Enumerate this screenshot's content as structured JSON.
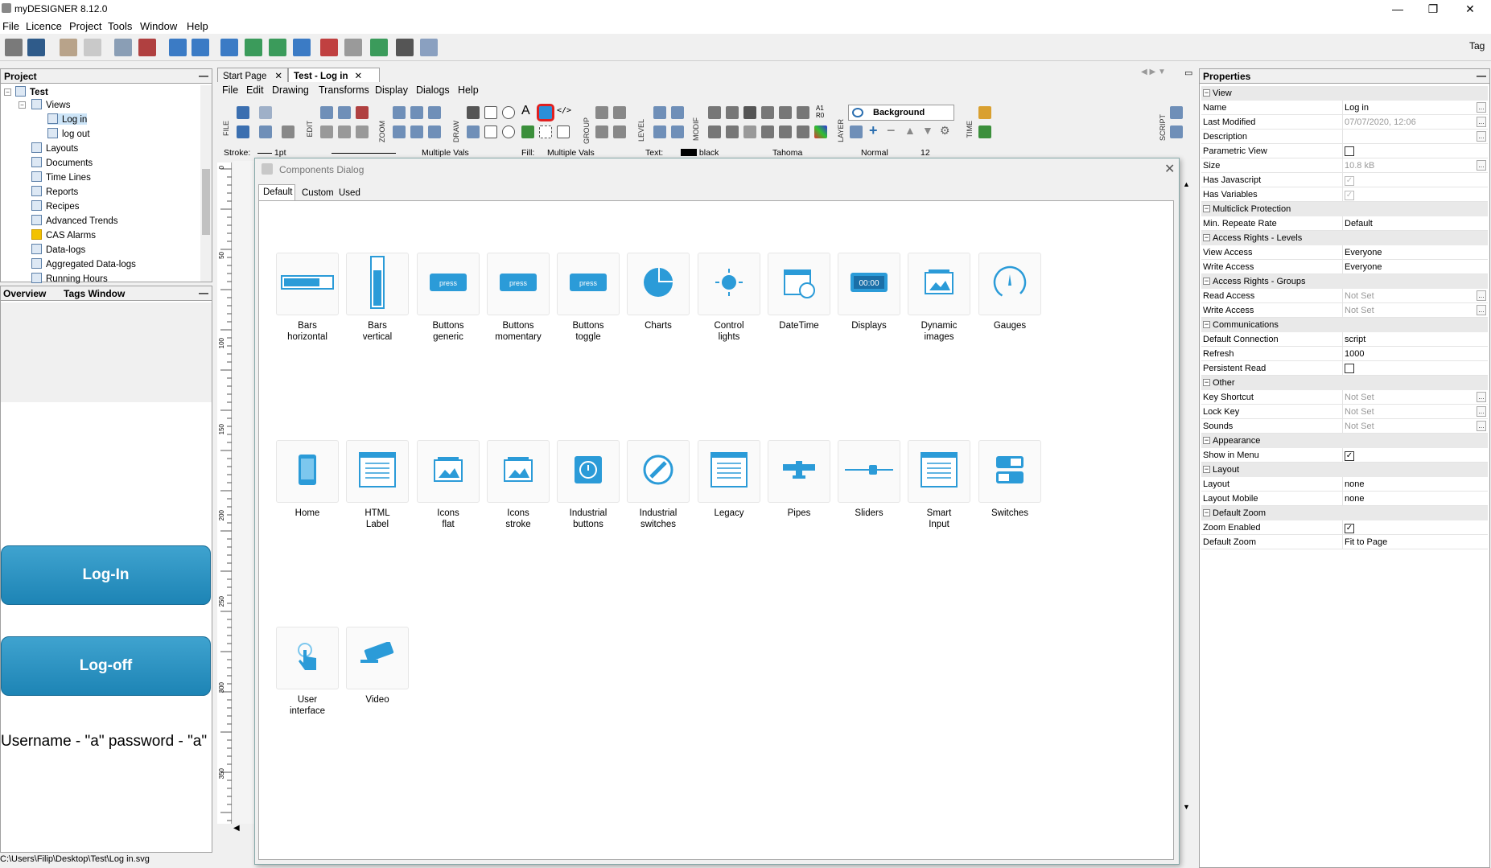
{
  "app": {
    "title": "myDESIGNER 8.12.0"
  },
  "window_controls": {
    "min": "—",
    "max": "❐",
    "close": "✕"
  },
  "menubar": [
    "File",
    "Licence",
    "Project",
    "Tools",
    "Window",
    "Help"
  ],
  "toolbar_right_label": "Tag",
  "project_panel": {
    "title": "Project",
    "root": "Test",
    "views": "Views",
    "view_items": [
      "Log in",
      "log out"
    ],
    "items": [
      "Layouts",
      "Documents",
      "Time Lines",
      "Reports",
      "Recipes",
      "Advanced Trends",
      "CAS Alarms",
      "Data-logs",
      "Aggregated Data-logs",
      "Running Hours"
    ]
  },
  "bottom_tabs": [
    "Overview",
    "Tags Window"
  ],
  "canvas_preview": {
    "login": "Log-In",
    "logoff": "Log-off",
    "hint": "Username - \"a\" password - \"a\""
  },
  "status_path": "C:\\Users\\Filip\\Desktop\\Test\\Log in.svg",
  "doc_tabs": [
    "Start Page",
    "Test - Log in"
  ],
  "doc_menu": [
    "File",
    "Edit",
    "Drawing",
    "Transforms",
    "Display",
    "Dialogs",
    "Help"
  ],
  "tool_groups": [
    "FILE",
    "EDIT",
    "ZOOM",
    "DRAW",
    "GROUP",
    "LEVEL",
    "MODIF",
    "LAYER",
    "TIME",
    "SCRIPT"
  ],
  "layer_select": "Background",
  "stylebar": {
    "stroke_label": "Stroke:",
    "stroke_value": "1pt",
    "stroke_multi": "Multiple Vals",
    "fill_label": "Fill:",
    "fill_value": "Multiple Vals",
    "text_label": "Text:",
    "text_color": "black",
    "font": "Tahoma",
    "weight": "Normal",
    "size": "12"
  },
  "dialog": {
    "title": "Components Dialog",
    "tabs": [
      "Default",
      "Custom",
      "Used"
    ],
    "components": [
      {
        "label": "Bars\nhorizontal",
        "icon": "bar-horizontal-icon"
      },
      {
        "label": "Bars\nvertical",
        "icon": "bar-vertical-icon"
      },
      {
        "label": "Buttons\ngeneric",
        "icon": "button-icon",
        "txt": "press"
      },
      {
        "label": "Buttons\nmomentary",
        "icon": "button-icon",
        "txt": "press"
      },
      {
        "label": "Buttons\ntoggle",
        "icon": "button-icon",
        "txt": "press"
      },
      {
        "label": "Charts",
        "icon": "pie-chart-icon"
      },
      {
        "label": "Control\nlights",
        "icon": "light-icon"
      },
      {
        "label": "DateTime",
        "icon": "calendar-icon"
      },
      {
        "label": "Displays",
        "icon": "display-icon",
        "txt": "00:00"
      },
      {
        "label": "Dynamic\nimages",
        "icon": "image-icon"
      },
      {
        "label": "Gauges",
        "icon": "gauge-icon"
      },
      {
        "label": "Home",
        "icon": "phone-icon"
      },
      {
        "label": "HTML\nLabel",
        "icon": "document-icon"
      },
      {
        "label": "Icons\nflat",
        "icon": "image-icon"
      },
      {
        "label": "Icons\nstroke",
        "icon": "image-icon"
      },
      {
        "label": "Industrial\nbuttons",
        "icon": "industrial-button-icon"
      },
      {
        "label": "Industrial\nswitches",
        "icon": "industrial-switch-icon"
      },
      {
        "label": "Legacy",
        "icon": "document-icon"
      },
      {
        "label": "Pipes",
        "icon": "pipe-icon"
      },
      {
        "label": "Sliders",
        "icon": "slider-icon"
      },
      {
        "label": "Smart\nInput",
        "icon": "document-icon"
      },
      {
        "label": "Switches",
        "icon": "switch-icon"
      },
      {
        "label": "User\ninterface",
        "icon": "touch-icon"
      },
      {
        "label": "Video",
        "icon": "camera-icon"
      }
    ]
  },
  "properties": {
    "title": "Properties",
    "rows": [
      {
        "cat": "View"
      },
      {
        "k": "Name",
        "v": "Log in",
        "dots": true
      },
      {
        "k": "Last Modified",
        "v": "07/07/2020, 12:06",
        "grey": true,
        "dots": true
      },
      {
        "k": "Description",
        "v": "",
        "dots": true
      },
      {
        "k": "Parametric View",
        "chk": ""
      },
      {
        "k": "Size",
        "v": "10.8 kB",
        "grey": true,
        "dots": true
      },
      {
        "k": "Has Javascript",
        "chk": "✓",
        "grey": true
      },
      {
        "k": "Has Variables",
        "chk": "✓",
        "grey": true
      },
      {
        "cat": "Multiclick Protection"
      },
      {
        "k": "Min. Repeate Rate",
        "v": "Default"
      },
      {
        "cat": "Access Rights - Levels"
      },
      {
        "k": "View Access",
        "v": "Everyone"
      },
      {
        "k": "Write Access",
        "v": "Everyone"
      },
      {
        "cat": "Access Rights - Groups"
      },
      {
        "k": "Read Access",
        "v": "Not Set",
        "grey": true,
        "dots": true
      },
      {
        "k": "Write Access",
        "v": "Not Set",
        "grey": true,
        "dots": true
      },
      {
        "cat": "Communications"
      },
      {
        "k": "Default Connection",
        "v": "script"
      },
      {
        "k": "Refresh",
        "v": "1000"
      },
      {
        "k": "Persistent Read",
        "chk": ""
      },
      {
        "cat": "Other"
      },
      {
        "k": "Key Shortcut",
        "v": "Not Set",
        "grey": true,
        "dots": true
      },
      {
        "k": "Lock Key",
        "v": "Not Set",
        "grey": true,
        "dots": true
      },
      {
        "k": "Sounds",
        "v": "Not Set",
        "grey": true,
        "dots": true
      },
      {
        "cat": "Appearance"
      },
      {
        "k": "Show in Menu",
        "chk": "✓"
      },
      {
        "cat": "Layout"
      },
      {
        "k": "Layout",
        "v": "none"
      },
      {
        "k": "Layout Mobile",
        "v": "none"
      },
      {
        "cat": "Default Zoom"
      },
      {
        "k": "Zoom Enabled",
        "chk": "✓"
      },
      {
        "k": "Default Zoom",
        "v": "Fit to Page"
      }
    ]
  },
  "ruler_marks": [
    "0",
    "50",
    "100",
    "150",
    "200",
    "250",
    "300",
    "350"
  ]
}
